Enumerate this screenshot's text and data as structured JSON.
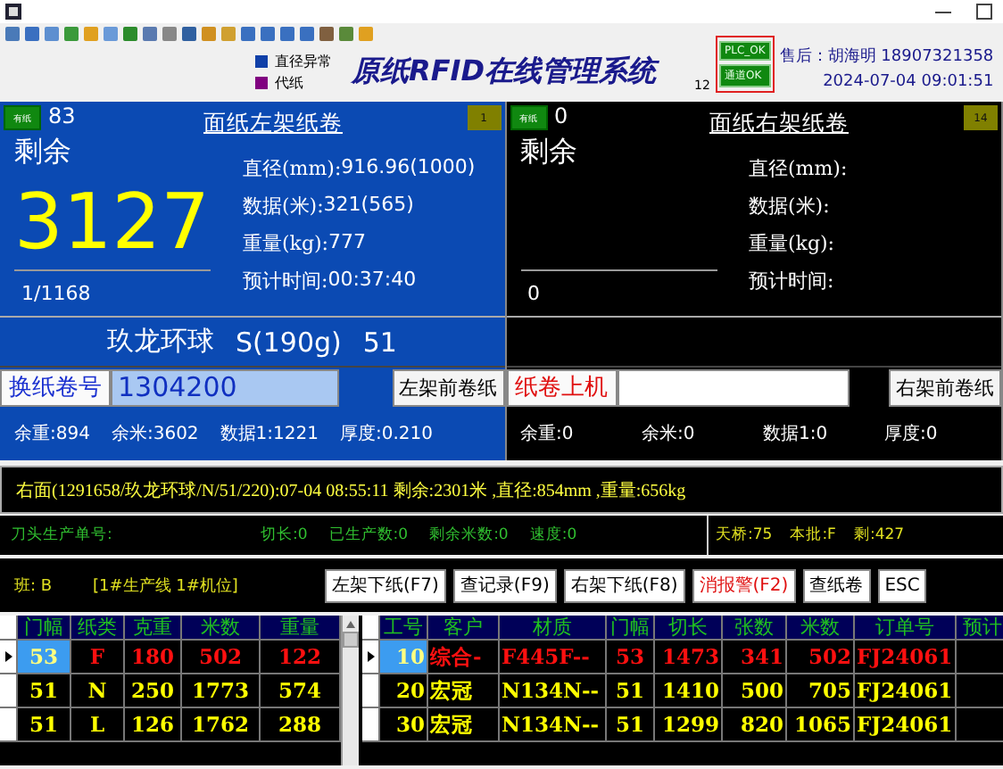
{
  "header": {
    "legend": [
      {
        "label": "直径异常",
        "color": "#1040a8"
      },
      {
        "label": "代纸",
        "color": "#800080"
      }
    ],
    "app_title": "原纸RFID在线管理系统",
    "counter": "12",
    "status_badges": [
      "PLC_OK",
      "通道OK"
    ],
    "support": "售后：胡海明 18907321358",
    "datetime": "2024-07-04 09:01:51"
  },
  "racks": [
    {
      "active": true,
      "paper_badge": "有纸",
      "count": "83",
      "title": "面纸左架纸卷",
      "slot": "1",
      "remaining_label": "剩余",
      "remaining": "3127",
      "progress": "1/1168",
      "fields": [
        {
          "label": "直径(mm):",
          "value": "916.96(1000)"
        },
        {
          "label": "数据(米):",
          "value": "321(565)"
        },
        {
          "label": "重量(kg):",
          "value": "777"
        },
        {
          "label": "预计时间:",
          "value": "00:37:40"
        }
      ],
      "product": [
        "玖龙环球",
        "S(190g)",
        "51"
      ],
      "action": {
        "label": "换纸卷号",
        "kind": "info"
      },
      "roll_no": "1304200",
      "front_button": "左架前卷纸",
      "stats": [
        "余重:894",
        "余米:3602",
        "数据1:1221",
        "厚度:0.210"
      ]
    },
    {
      "active": false,
      "paper_badge": "有纸",
      "count": "0",
      "title": "面纸右架纸卷",
      "slot": "14",
      "remaining_label": "剩余",
      "progress": "0",
      "fields": [
        {
          "label": "直径(mm):"
        },
        {
          "label": "数据(米):"
        },
        {
          "label": "重量(kg):"
        },
        {
          "label": "预计时间:"
        }
      ],
      "action": {
        "label": "纸卷上机",
        "kind": "alert"
      },
      "front_button": "右架前卷纸",
      "stats": [
        "余重:0",
        "余米:0",
        "数据1:0",
        "厚度:0"
      ]
    }
  ],
  "message": "右面(1291658/玖龙环球/N/51/220):07-04 08:55:11 剩余:2301米 ,直径:854mm ,重量:656kg",
  "production": [
    "刀头生产单号:",
    "切长:0",
    "已生产数:0",
    "剩余米数:0",
    "速度:0"
  ],
  "bridge": [
    "天桥:75",
    "本批:F",
    "剩:427"
  ],
  "shift": "班: B",
  "position": "[1#生产线 1#机位]",
  "buttons": [
    {
      "label": "左架下纸(F7)",
      "kind": "normal"
    },
    {
      "label": "查记录(F9)",
      "kind": "normal"
    },
    {
      "label": "右架下纸(F8)",
      "kind": "normal"
    },
    {
      "label": "消报警(F2)",
      "kind": "alert"
    },
    {
      "label": "查纸卷",
      "kind": "normal"
    },
    {
      "label": "ESC",
      "kind": "normal"
    }
  ],
  "left_grid": {
    "columns": [
      "门幅",
      "纸类",
      "克重",
      "米数",
      "重量"
    ],
    "rows": [
      {
        "selected": true,
        "cells": [
          "53",
          "F",
          "180",
          "502",
          "122"
        ]
      },
      {
        "selected": false,
        "cells": [
          "51",
          "N",
          "250",
          "1773",
          "574"
        ]
      },
      {
        "selected": false,
        "cells": [
          "51",
          "L",
          "126",
          "1762",
          "288"
        ]
      }
    ]
  },
  "right_grid": {
    "columns": [
      "工号",
      "客户",
      "材质",
      "门幅",
      "切长",
      "张数",
      "米数",
      "订单号",
      "预计"
    ],
    "rows": [
      {
        "selected": true,
        "cells": [
          "10",
          "综合-",
          "F445F--",
          "53",
          "1473",
          "341",
          "502",
          "FJ24061"
        ]
      },
      {
        "selected": false,
        "cells": [
          "20",
          "宏冠",
          "N134N--",
          "51",
          "1410",
          "500",
          "705",
          "FJ24061"
        ]
      },
      {
        "selected": false,
        "cells": [
          "30",
          "宏冠",
          "N134N--",
          "51",
          "1299",
          "820",
          "1065",
          "FJ24061"
        ]
      }
    ]
  }
}
